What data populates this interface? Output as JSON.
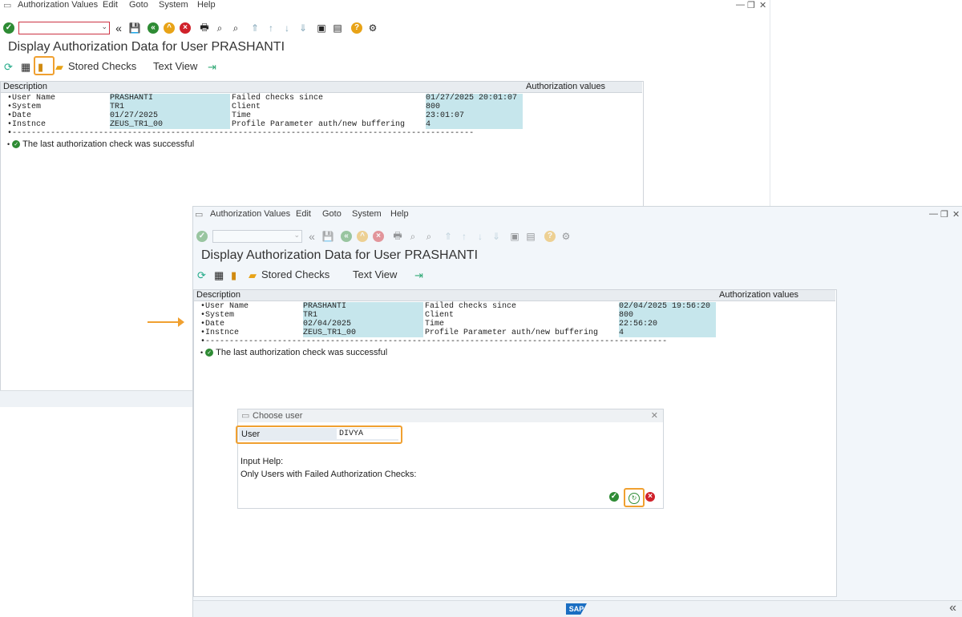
{
  "win1": {
    "menu": [
      "Authorization Values",
      "Edit",
      "Goto",
      "System",
      "Help"
    ],
    "title": "Display Authorization Data for User PRASHANTI",
    "stored_checks": "Stored Checks",
    "text_view": "Text View",
    "col_description": "Description",
    "col_auth_values": "Authorization values",
    "rows": [
      {
        "label": "User Name",
        "value": "PRASHANTI",
        "label2": "Failed checks since",
        "value2": "01/27/2025 20:01:07"
      },
      {
        "label": "System",
        "value": "TR1",
        "label2": "Client",
        "value2": "800"
      },
      {
        "label": "Date",
        "value": "01/27/2025",
        "label2": "Time",
        "value2": "23:01:07"
      },
      {
        "label": "Instnce",
        "value": "ZEUS_TR1_00",
        "label2": "Profile Parameter auth/new buffering",
        "value2": "4"
      }
    ],
    "success_msg": "The last authorization check was successful"
  },
  "win2": {
    "menu": [
      "Authorization Values",
      "Edit",
      "Goto",
      "System",
      "Help"
    ],
    "title": "Display Authorization Data for User PRASHANTI",
    "stored_checks": "Stored Checks",
    "text_view": "Text View",
    "col_description": "Description",
    "col_auth_values": "Authorization values",
    "rows": [
      {
        "label": "User Name",
        "value": "PRASHANTI",
        "label2": "Failed checks since",
        "value2": "02/04/2025 19:56:20"
      },
      {
        "label": "System",
        "value": "TR1",
        "label2": "Client",
        "value2": "800"
      },
      {
        "label": "Date",
        "value": "02/04/2025",
        "label2": "Time",
        "value2": "22:56:20"
      },
      {
        "label": "Instnce",
        "value": "ZEUS_TR1_00",
        "label2": "Profile Parameter auth/new buffering",
        "value2": "4"
      }
    ],
    "success_msg": "The last authorization check was successful"
  },
  "dialog": {
    "title": "Choose user",
    "user_label": "User",
    "user_value": "DIVYA",
    "input_help": "Input Help:",
    "only_failed": "Only Users with Failed Authorization Checks:"
  },
  "status": {
    "logo": "SAP"
  },
  "colors": {
    "accent": "#f0a030",
    "highlight": "#c6e6ec",
    "ok": "#2e8b34",
    "cancel": "#d0212a",
    "nav": "#e8a317"
  }
}
